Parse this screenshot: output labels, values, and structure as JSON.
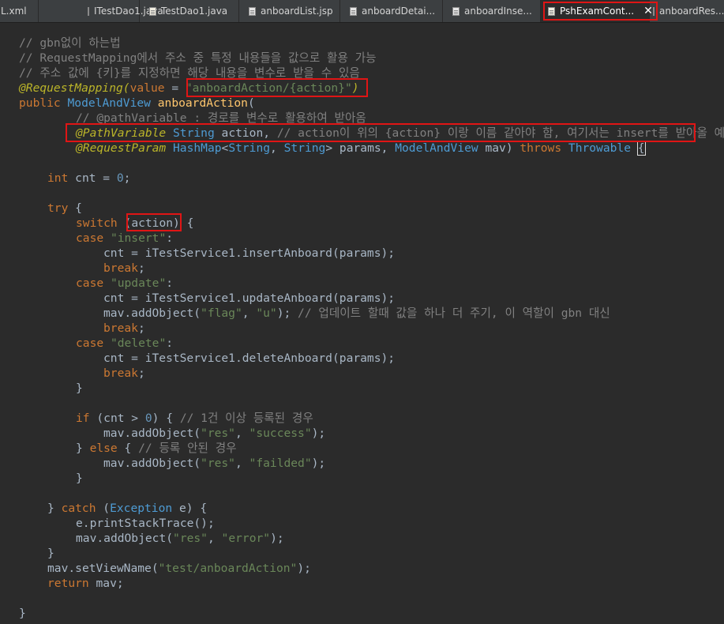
{
  "tabs": [
    {
      "label": "L.xml",
      "icon": "xml-file-icon"
    },
    {
      "label": "ITestDao1.java",
      "icon": "java-file-icon"
    },
    {
      "label": "TestDao1.java",
      "icon": "java-file-icon"
    },
    {
      "label": "anboardList.jsp",
      "icon": "jsp-file-icon"
    },
    {
      "label": "anboardDetai...",
      "icon": "jsp-file-icon"
    },
    {
      "label": "anboardInse...",
      "icon": "jsp-file-icon"
    },
    {
      "label": "PshExamCont...",
      "icon": "java-file-icon",
      "active": true,
      "close": "✕"
    },
    {
      "label": "anboardRes...",
      "icon": "jsp-file-icon"
    }
  ],
  "code": {
    "c1": "// gbn없이 하는법",
    "c2": "// RequestMapping에서 주소 중 특정 내용들을 값으로 활용 가능",
    "c3": "// 주소 값에 {키}를 지정하면 해당 내용을 변수로 받을 수 있음",
    "l4_anno": "@RequestMapping(",
    "l4_value": "value",
    "l4_eq": " = ",
    "l4_str": "\"anboardAction/{action}\"",
    "l4_close": ")",
    "l5_public": "public ",
    "l5_type": "ModelAndView ",
    "l5_name": "anboardAction",
    "l5_paren": "(",
    "l6_comment": "// @pathVariable : 경로를 변수로 활용하여 받아옴",
    "l7_anno": "@PathVariable ",
    "l7_type": "String ",
    "l7_param": "action",
    "l7_comma": ", ",
    "l7_comment": "// action이 위의 {action} 이랑 이름 같아야 함, 여기서는 insert를 받아올 예정",
    "l8_anno": "@RequestParam ",
    "l8_type1": "HashMap",
    "l8_lt": "<",
    "l8_type2": "String",
    "l8_c": ", ",
    "l8_type3": "String",
    "l8_gt": "> ",
    "l8_p1": "params",
    "l8_c2": ", ",
    "l8_type4": "ModelAndView ",
    "l8_p2": "mav",
    "l8_close": ") ",
    "l8_throws": "throws ",
    "l8_type5": "Throwable ",
    "l8_brace": "{",
    "l9_int": "int ",
    "l9_var": "cnt",
    "l9_eq": " = ",
    "l9_num": "0",
    "l9_semi": ";",
    "l10_try": "try ",
    "l10_brace": "{",
    "l11_switch": "switch ",
    "l11_open": "(",
    "l11_var": "action",
    "l11_close": ")",
    "l11_brace": " {",
    "l12_case": "case ",
    "l12_str": "\"insert\"",
    "l12_colon": ":",
    "l13_var": "cnt",
    "l13_eq": " = ",
    "l13_obj": "iTestService1",
    "l13_dot": ".",
    "l13_fn": "insertAnboard",
    "l13_open": "(",
    "l13_arg": "params",
    "l13_close": ");",
    "l14_break": "break",
    "l14_semi": ";",
    "l15_case": "case ",
    "l15_str": "\"update\"",
    "l15_colon": ":",
    "l16_var": "cnt",
    "l16_eq": " = ",
    "l16_obj": "iTestService1",
    "l16_dot": ".",
    "l16_fn": "updateAnboard",
    "l16_open": "(",
    "l16_arg": "params",
    "l16_close": ");",
    "l17_var": "mav",
    "l17_dot": ".",
    "l17_fn": "addObject",
    "l17_open": "(",
    "l17_s1": "\"flag\"",
    "l17_c": ", ",
    "l17_s2": "\"u\"",
    "l17_close": "); ",
    "l17_comment": "// 업데이트 할때 값을 하나 더 주기, 이 역할이 gbn 대신",
    "l18_break": "break",
    "l18_semi": ";",
    "l19_case": "case ",
    "l19_str": "\"delete\"",
    "l19_colon": ":",
    "l20_var": "cnt",
    "l20_eq": " = ",
    "l20_obj": "iTestService1",
    "l20_dot": ".",
    "l20_fn": "deleteAnboard",
    "l20_open": "(",
    "l20_arg": "params",
    "l20_close": ");",
    "l21_break": "break",
    "l21_semi": ";",
    "l22_brace": "}",
    "l23_if": "if ",
    "l23_open": "(",
    "l23_var": "cnt",
    "l23_gt": " > ",
    "l23_num": "0",
    "l23_close": ") { ",
    "l23_comment": "// 1건 이상 등록된 경우",
    "l24_var": "mav",
    "l24_dot": ".",
    "l24_fn": "addObject",
    "l24_open": "(",
    "l24_s1": "\"res\"",
    "l24_c": ", ",
    "l24_s2": "\"success\"",
    "l24_close": ");",
    "l25_brace": "} ",
    "l25_else": "else ",
    "l25_open": "{ ",
    "l25_comment": "// 등록 안된 경우",
    "l26_var": "mav",
    "l26_dot": ".",
    "l26_fn": "addObject",
    "l26_open": "(",
    "l26_s1": "\"res\"",
    "l26_c": ", ",
    "l26_s2": "\"failded\"",
    "l26_close": ");",
    "l27_brace": "}",
    "l28_brace": "} ",
    "l28_catch": "catch ",
    "l28_open": "(",
    "l28_type": "Exception ",
    "l28_var": "e",
    "l28_close": ") {",
    "l29_var": "e",
    "l29_dot": ".",
    "l29_fn": "printStackTrace",
    "l29_close": "();",
    "l30_var": "mav",
    "l30_dot": ".",
    "l30_fn": "addObject",
    "l30_open": "(",
    "l30_s1": "\"res\"",
    "l30_c": ", ",
    "l30_s2": "\"error\"",
    "l30_close": ");",
    "l31_brace": "}",
    "l32_var": "mav",
    "l32_dot": ".",
    "l32_fn": "setViewName",
    "l32_open": "(",
    "l32_s1": "\"test/anboardAction\"",
    "l32_close": ");",
    "l33_return": "return ",
    "l33_var": "mav",
    "l33_semi": ";",
    "l34_brace": "}"
  },
  "colors": {
    "background": "#2b2b2b",
    "keyword": "#cc7832",
    "string": "#6a8759",
    "comment": "#808080",
    "annotation": "#bbb529",
    "method": "#ffc66d",
    "field": "#9876aa",
    "highlight_box": "#e01515"
  }
}
